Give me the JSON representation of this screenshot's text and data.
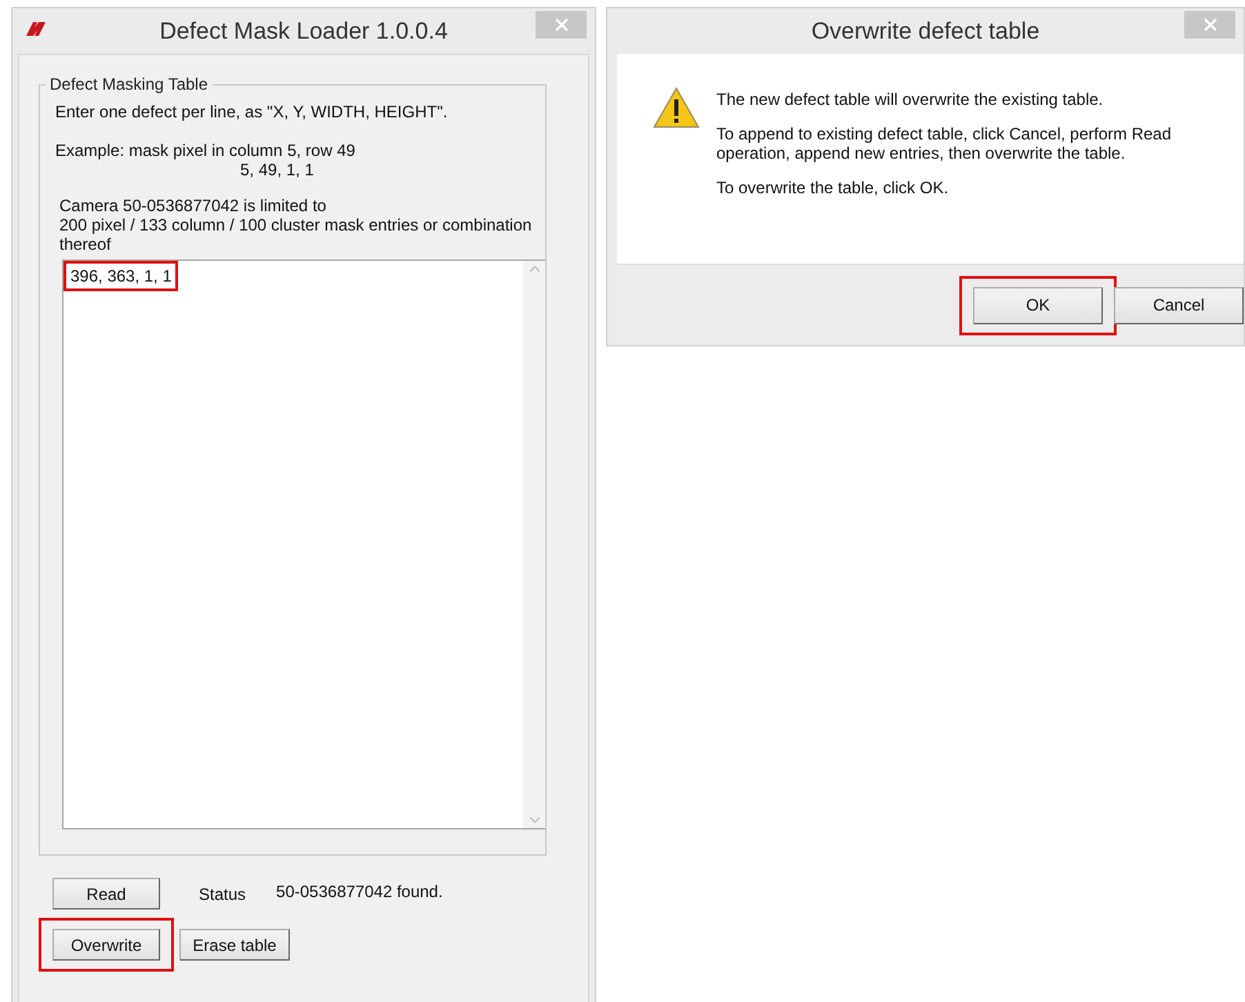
{
  "main_window": {
    "title": "Defect Mask Loader 1.0.0.4",
    "group": {
      "title": "Defect Masking Table",
      "instruction": "Enter one defect per line, as  \"X, Y, WIDTH, HEIGHT\".",
      "example": "Example: mask pixel in column 5, row 49",
      "example_value": "5, 49, 1, 1",
      "camera_note": [
        "Camera 50-0536877042 is limited to",
        "200 pixel / 133 column / 100 cluster mask entries or combination",
        "thereof"
      ],
      "entries": [
        {
          "text": "396, 363, 1, 1",
          "highlighted": true
        }
      ]
    },
    "read_button": {
      "label": "Read"
    },
    "status_label": "Status",
    "status_value": "50-0536877042 found.",
    "overwrite_button": {
      "label": "Overwrite",
      "highlighted": true
    },
    "erase_button": {
      "label": "Erase table"
    }
  },
  "dialog": {
    "title": "Overwrite defect table",
    "messages": [
      "The new defect table will overwrite the existing table.",
      "To append to existing defect table, click Cancel, perform Read operation, append new entries, then overwrite the table.",
      "To overwrite the table, click OK."
    ],
    "buttons": [
      {
        "label": "OK",
        "highlighted": true
      },
      {
        "label": "Cancel",
        "highlighted": false
      }
    ]
  }
}
